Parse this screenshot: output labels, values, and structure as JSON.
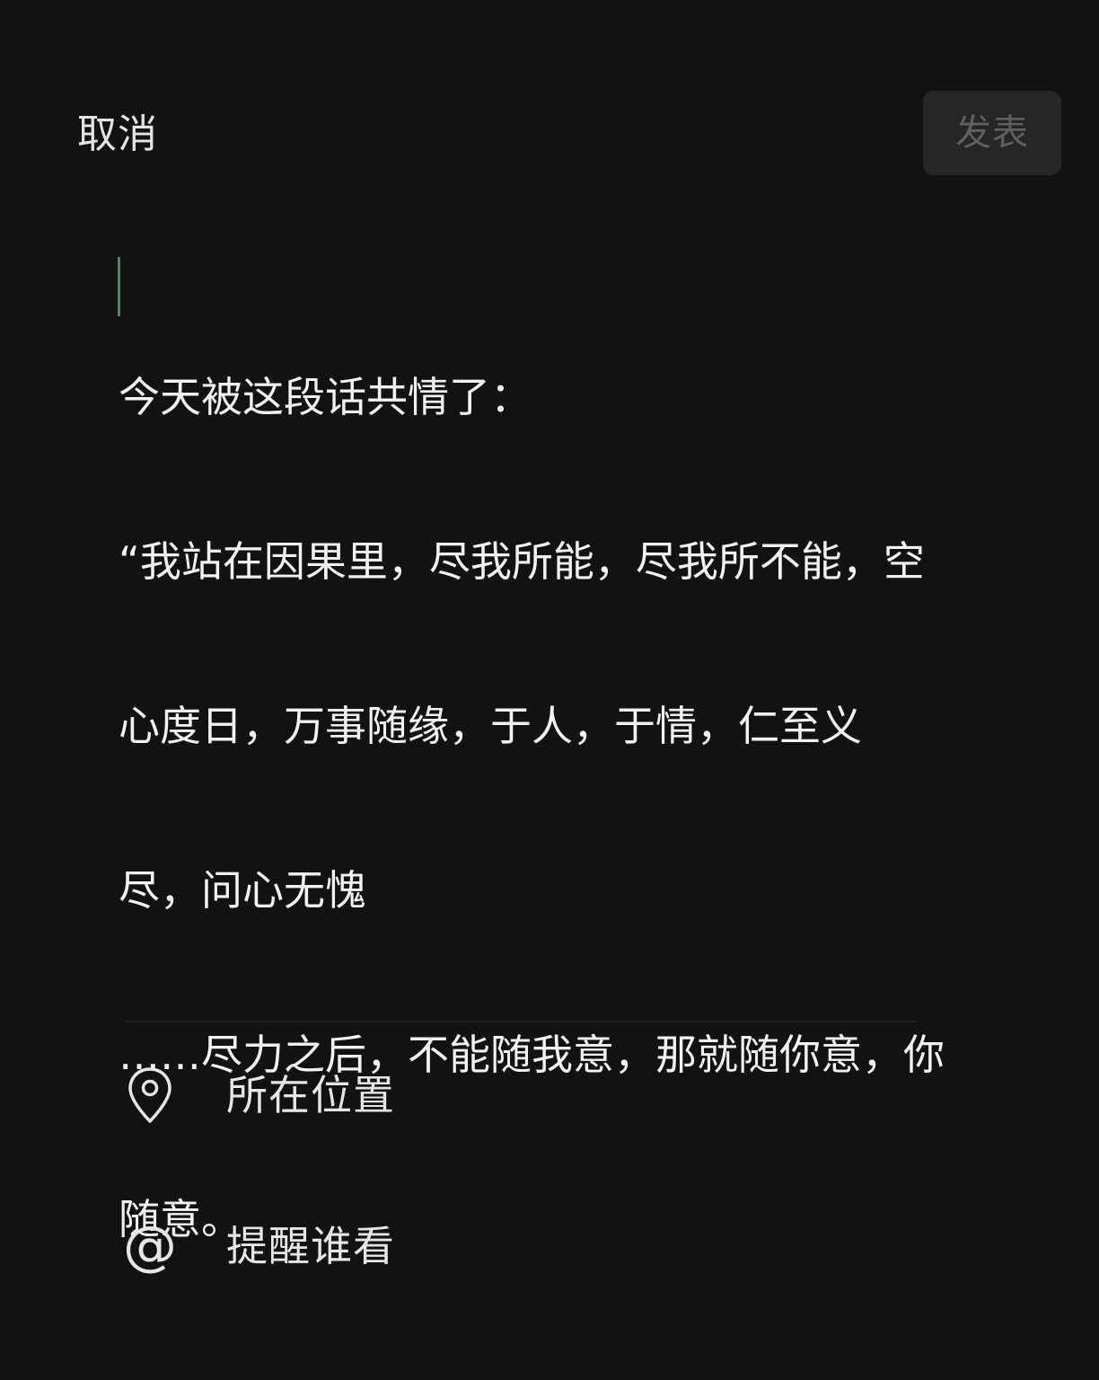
{
  "header": {
    "cancel_label": "取消",
    "publish_label": "发表"
  },
  "editor": {
    "lines": [
      "今天被这段话共情了：",
      "“我站在因果里，尽我所能，尽我所不能，空",
      "心度日，万事随缘，于人，于情，仁至义",
      "尽，问心无愧",
      "……尽力之后，不能随我意，那就随你意，你",
      "随意。"
    ]
  },
  "options": {
    "location": {
      "label": "所在位置",
      "icon": "location-pin-icon"
    },
    "mention": {
      "label": "提醒谁看",
      "icon": "at-sign-icon",
      "glyph": "@"
    }
  },
  "colors": {
    "background": "#121212",
    "publish_button_bg": "#262626",
    "publish_button_text": "#5f5f5f",
    "caret": "#3f8f5e",
    "text": "#f2f2f2"
  }
}
